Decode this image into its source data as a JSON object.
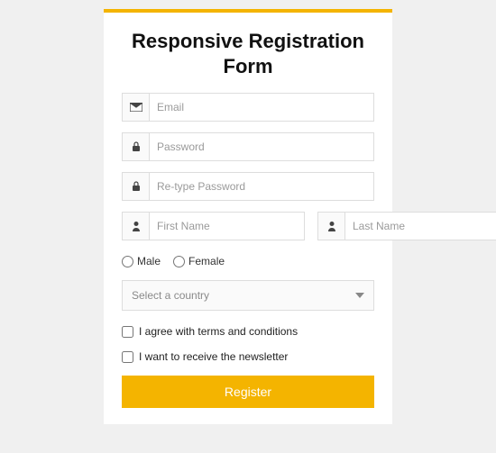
{
  "title": "Responsive Registration Form",
  "fields": {
    "email_placeholder": "Email",
    "password_placeholder": "Password",
    "repassword_placeholder": "Re-type Password",
    "firstname_placeholder": "First Name",
    "lastname_placeholder": "Last Name"
  },
  "gender": {
    "male_label": "Male",
    "female_label": "Female"
  },
  "country_select": "Select a country",
  "checks": {
    "terms_label": "I agree with terms and conditions",
    "newsletter_label": "I want to receive the newsletter"
  },
  "submit_label": "Register"
}
